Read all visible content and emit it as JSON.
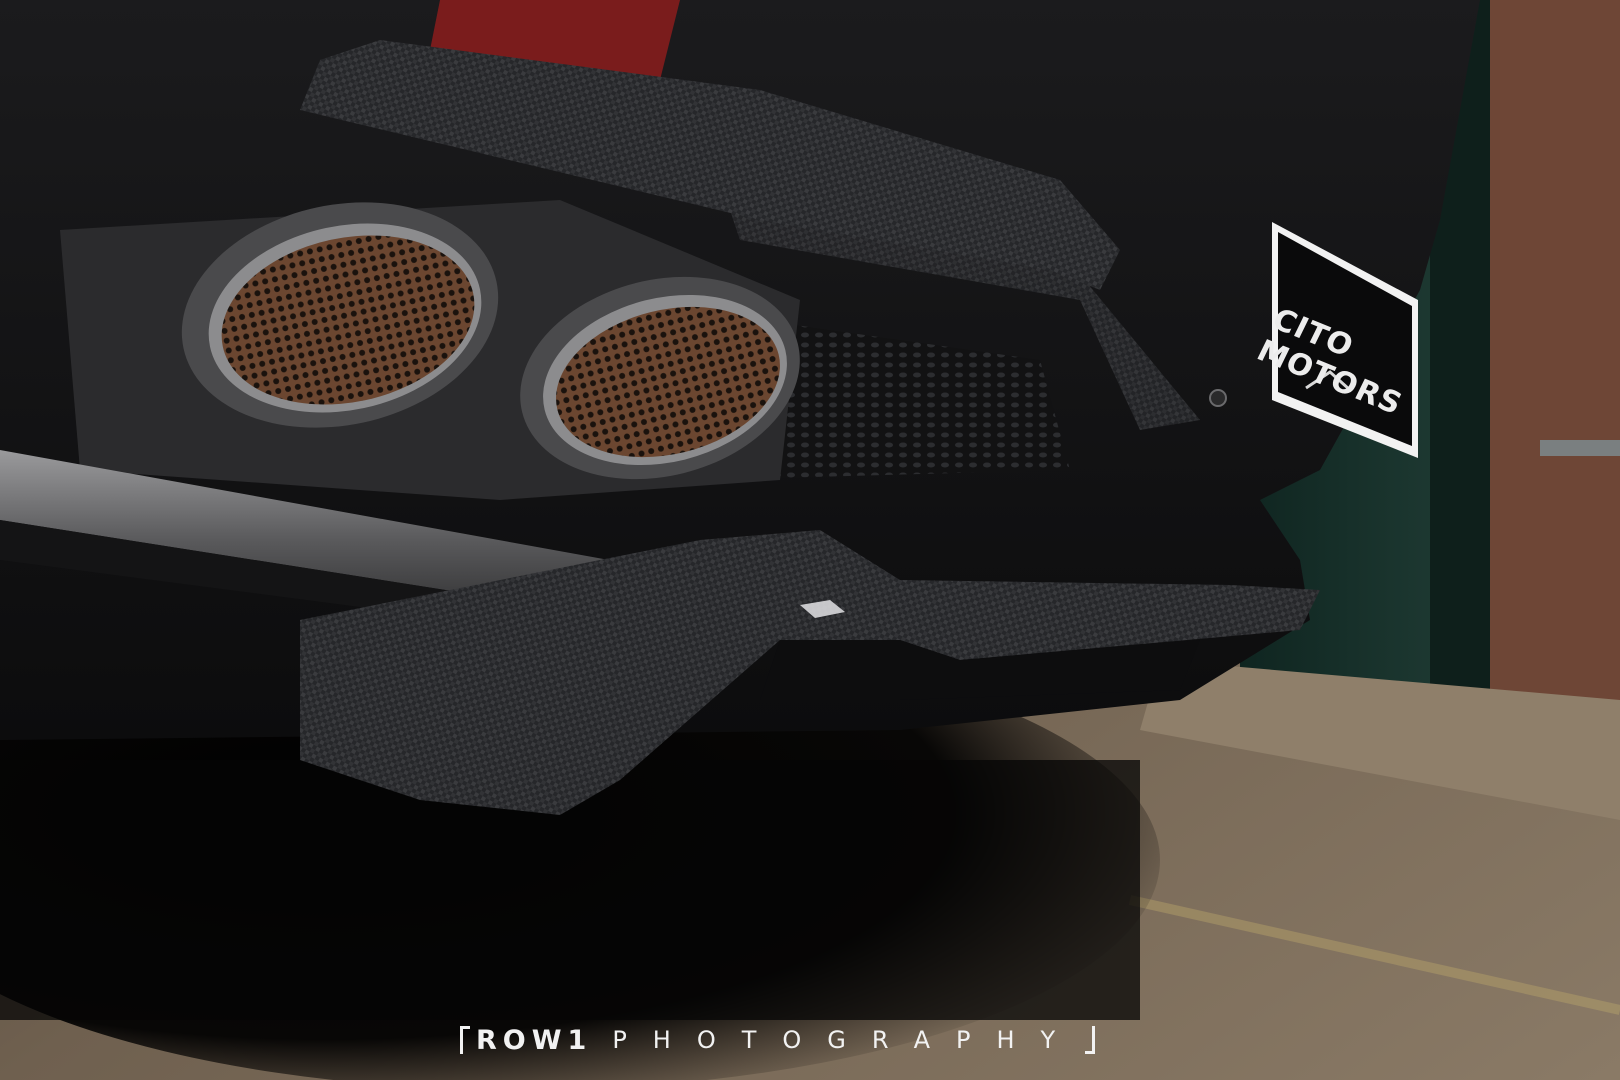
{
  "photo": {
    "subject": "",
    "plate": {
      "text": "CITO MOTORS"
    },
    "watermark": {
      "brand": "ROW1",
      "sub": "PHOTOGRAPHY"
    },
    "colors": {
      "body": "#141416",
      "carbon": "#2b2c2e",
      "shadow": "#050505",
      "ground": "#6d5e4e",
      "wall": "#1f3a33",
      "brick": "#7a4a3a",
      "exhaust_inner": "#8a5a3a",
      "taillight": "#7a1c1c"
    }
  }
}
